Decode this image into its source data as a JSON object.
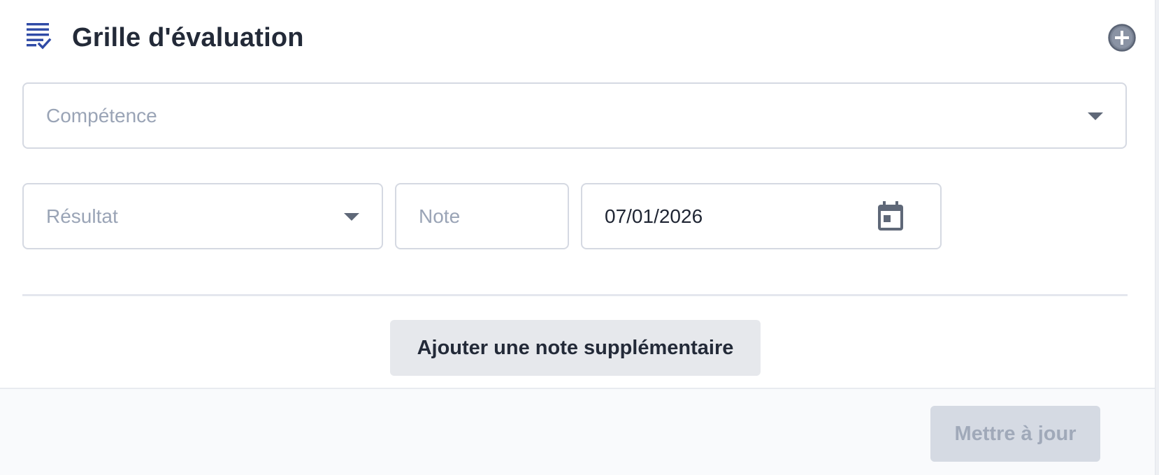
{
  "header": {
    "title": "Grille d'évaluation",
    "icon": "checklist-icon",
    "add_icon": "plus-circle-icon"
  },
  "form": {
    "competence": {
      "placeholder": "Compétence"
    },
    "resultat": {
      "placeholder": "Résultat"
    },
    "note": {
      "placeholder": "Note"
    },
    "date": {
      "value": "07/01/2026",
      "icon": "calendar-icon"
    }
  },
  "actions": {
    "add_note_label": "Ajouter une note supplémentaire",
    "update_label": "Mettre à jour"
  },
  "colors": {
    "accent": "#2f4aa6",
    "text": "#232a38",
    "placeholder": "#9aa4b6",
    "border": "#d5d9e2",
    "disabled_button_bg": "#d5dae3",
    "disabled_button_text": "#a0a9b9"
  }
}
